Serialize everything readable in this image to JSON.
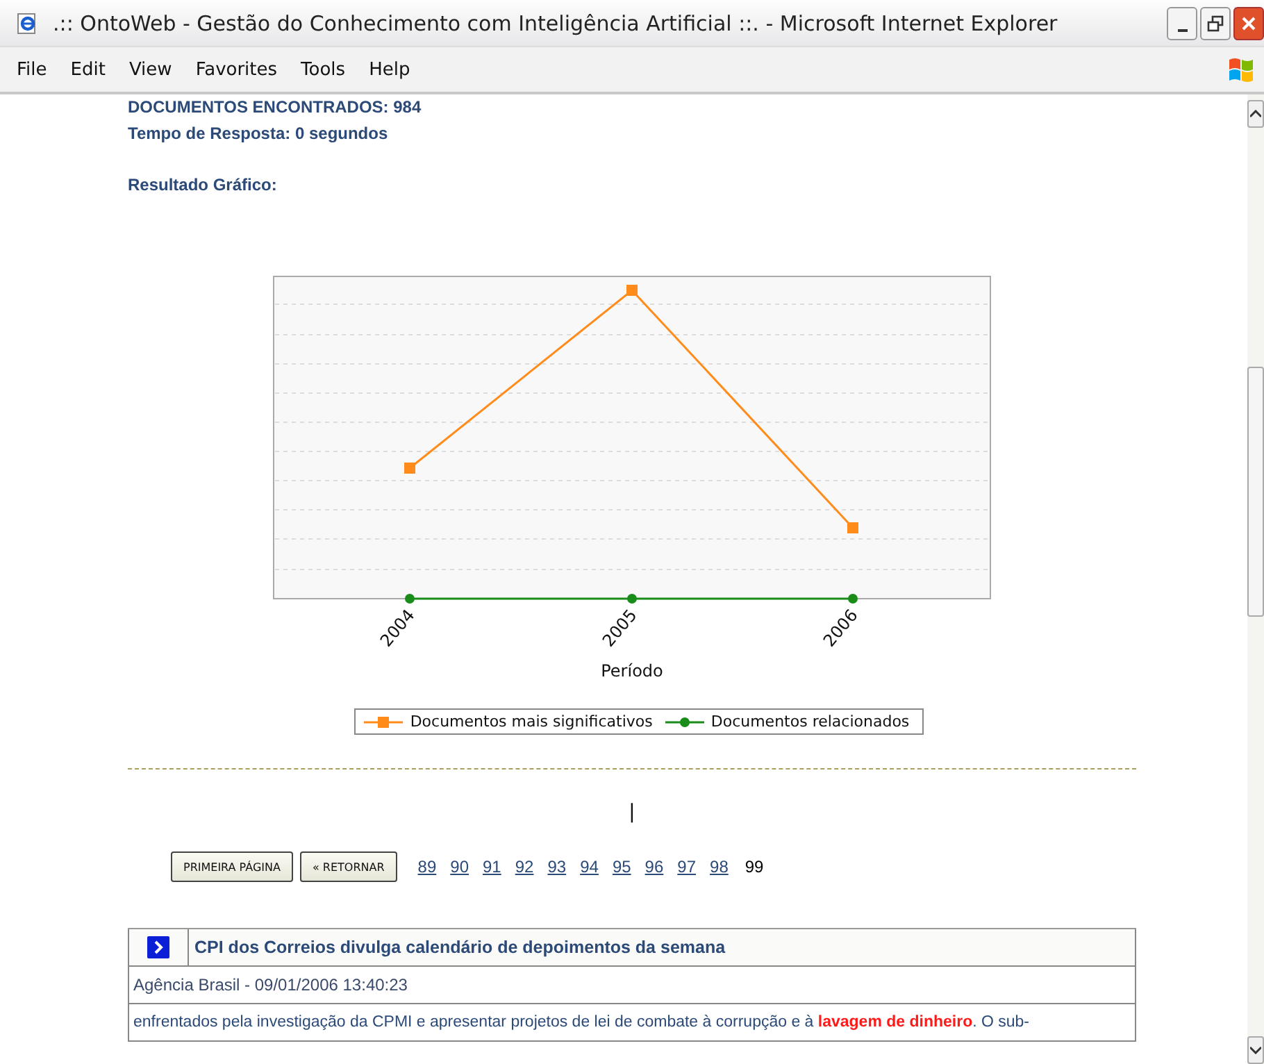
{
  "window": {
    "title": ".:: OntoWeb - Gestão do Conhecimento com Inteligência Artificial ::. - Microsoft Internet Explorer"
  },
  "menu": [
    {
      "label": "File"
    },
    {
      "label": "Edit"
    },
    {
      "label": "View"
    },
    {
      "label": "Favorites"
    },
    {
      "label": "Tools"
    },
    {
      "label": "Help"
    }
  ],
  "summary": [
    "DOCUMENTOS ENCONTRADOS: 984",
    "Tempo de Resposta: 0 segundos"
  ],
  "chart_heading": "Resultado Gráfico:",
  "chart": {
    "categories": [
      "2004",
      "2005",
      "2006"
    ],
    "xlabel": "Período",
    "legend": [
      {
        "name": "Documentos mais significativos",
        "color": "#ff8c1a",
        "kind": "square"
      },
      {
        "name": "Documentos relacionados",
        "color": "#1a8c1a",
        "kind": "circle"
      }
    ]
  },
  "cursor_mark": "|",
  "pagination": {
    "buttons": [
      "PRIMEIRA PÁGINA",
      "« RETORNAR"
    ],
    "pages": [
      {
        "label": "89",
        "selected": false
      },
      {
        "label": "90",
        "selected": false
      },
      {
        "label": "91",
        "selected": false
      },
      {
        "label": "92",
        "selected": false
      },
      {
        "label": "93",
        "selected": false
      },
      {
        "label": "94",
        "selected": false
      },
      {
        "label": "95",
        "selected": false
      },
      {
        "label": "96",
        "selected": false
      },
      {
        "label": "97",
        "selected": false
      },
      {
        "label": "98",
        "selected": false
      },
      {
        "label": "99",
        "selected": true
      }
    ]
  },
  "result": {
    "title": "CPI dos Correios divulga calendário de depoimentos da semana",
    "source": "Agência Brasil - 09/01/2006 13:40:23",
    "excerpt": [
      {
        "text": "enfrentados pela investigação da CPMI e apresentar projetos de lei de combate à corrupção e à ",
        "highlight": false
      },
      {
        "text": "lavagem de dinheiro",
        "highlight": true
      },
      {
        "text": ". O sub-",
        "highlight": false
      }
    ]
  }
}
